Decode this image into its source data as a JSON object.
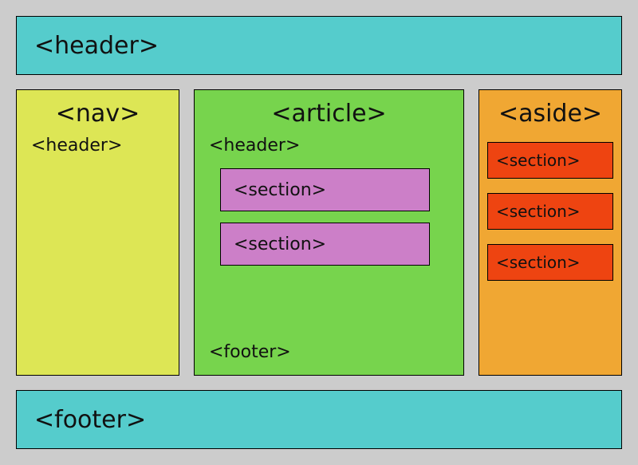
{
  "page_header": "<header>",
  "page_footer": "<footer>",
  "nav": {
    "title": "<nav>",
    "header": "<header>"
  },
  "article": {
    "title": "<article>",
    "header": "<header>",
    "sections": [
      "<section>",
      "<section>"
    ],
    "footer": "<footer>"
  },
  "aside": {
    "title": "<aside>",
    "sections": [
      "<section>",
      "<section>",
      "<section>"
    ]
  },
  "colors": {
    "background": "#cccccc",
    "header_footer": "#55cccc",
    "nav": "#dde655",
    "article": "#77d44d",
    "aside": "#f0a733",
    "article_section": "#cc7fc8",
    "aside_section": "#ee4411"
  }
}
